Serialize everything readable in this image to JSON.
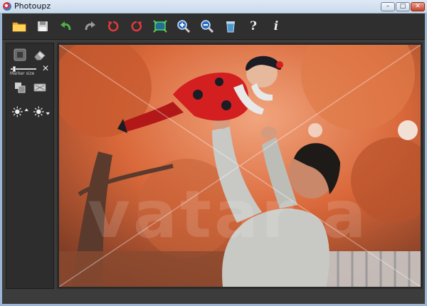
{
  "window": {
    "title": "Photoupz",
    "controls": {
      "minimize": "–",
      "maximize": "□",
      "close": "✕"
    }
  },
  "toolbar": {
    "buttons": [
      {
        "name": "open-folder",
        "icon": "folder-icon"
      },
      {
        "name": "save",
        "icon": "floppy-icon"
      },
      {
        "name": "undo",
        "icon": "undo-arrow-icon"
      },
      {
        "name": "redo",
        "icon": "redo-arrow-icon"
      },
      {
        "name": "rotate-left",
        "icon": "rotate-left-icon"
      },
      {
        "name": "rotate-right",
        "icon": "rotate-right-icon"
      },
      {
        "name": "fit-screen",
        "icon": "fit-screen-icon"
      },
      {
        "name": "zoom-in",
        "icon": "zoom-in-icon"
      },
      {
        "name": "zoom-out",
        "icon": "zoom-out-icon"
      },
      {
        "name": "delete",
        "icon": "trash-icon"
      },
      {
        "name": "help",
        "icon": "question-icon",
        "label": "?"
      },
      {
        "name": "info",
        "icon": "info-icon",
        "label": "i"
      }
    ]
  },
  "sidebar": {
    "marker_size_label": "Marker size",
    "marker_size_clear": "✕",
    "marker_size_value": 0.1
  },
  "photo": {
    "watermark": "vatar a",
    "colors": {
      "foliage": "#d9683a",
      "sweater": "#c8c8c4",
      "suit": "#d31f1f",
      "hat": "#1c1c24"
    }
  }
}
